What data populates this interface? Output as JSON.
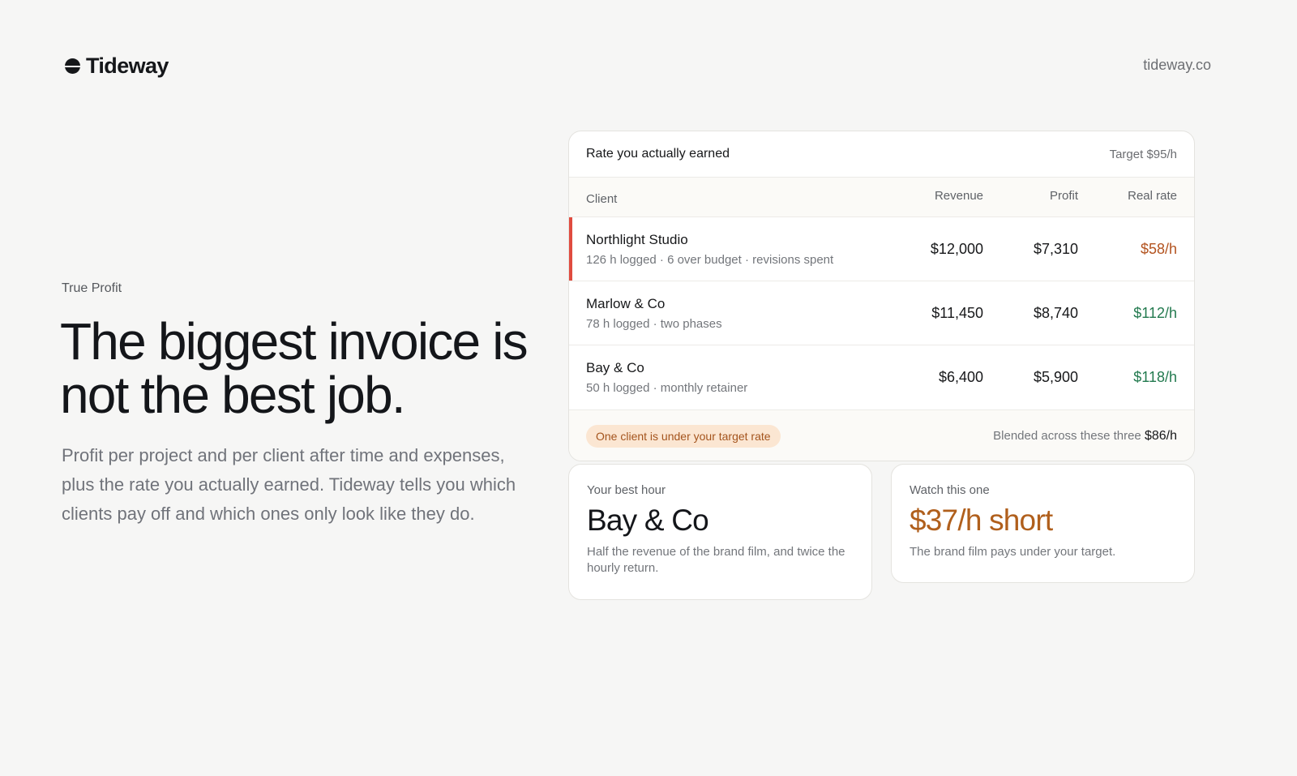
{
  "header": {
    "brand": "Tideway",
    "site": "tideway.co"
  },
  "hero": {
    "eyebrow": "True Profit",
    "headline": "The biggest invoice is not the best job.",
    "lede": "Profit per project and per client after time and expenses, plus the rate you actually earned. Tideway tells you which clients pay off and which ones only look like they do."
  },
  "card": {
    "title": "Rate you actually earned",
    "target": "Target $95/h",
    "columns": [
      "Client",
      "Revenue",
      "Profit",
      "Real rate"
    ],
    "rows": [
      {
        "client": "Northlight Studio",
        "meta": "126 h logged · 6 over budget · revisions spent",
        "revenue": "$12,000",
        "profit": "$7,310",
        "rate": "$58/h",
        "status": "under"
      },
      {
        "client": "Marlow & Co",
        "meta": "78 h logged · two phases",
        "revenue": "$11,450",
        "profit": "$8,740",
        "rate": "$112/h",
        "status": "over"
      },
      {
        "client": "Bay & Co",
        "meta": "50 h logged · monthly retainer",
        "revenue": "$6,400",
        "profit": "$5,900",
        "rate": "$118/h",
        "status": "over"
      }
    ],
    "alert": "One client is under your target rate",
    "blend_label": "Blended across these three",
    "blend_value": "$86/h"
  },
  "best": {
    "label": "Your best hour",
    "value": "Bay & Co",
    "text": "Half the revenue of the brand film, and twice the hourly return."
  },
  "watch": {
    "label": "Watch this one",
    "value": "$37/h short",
    "text": "The brand film pays under your target."
  },
  "colors": {
    "background": "#f6f6f5",
    "flag": "#e04b3f",
    "rate_under": "#b3531f",
    "rate_over": "#237a4f",
    "warn": "#b05f1c",
    "pill_bg": "#fbe6d2"
  }
}
